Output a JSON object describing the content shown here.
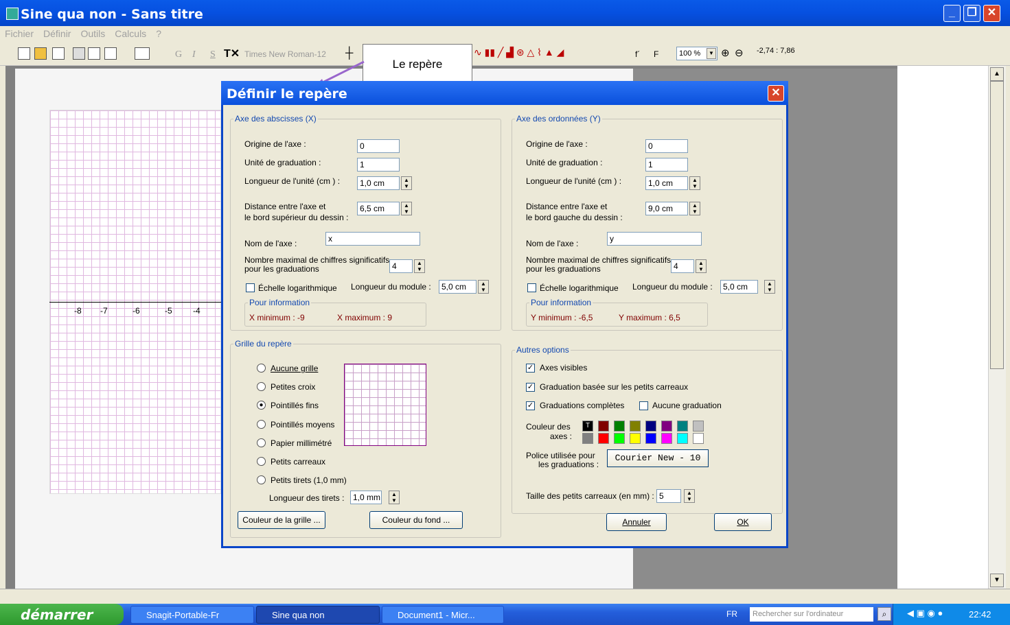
{
  "window": {
    "title": "Sine qua non - Sans titre"
  },
  "menu": [
    "Fichier",
    "Définir",
    "Outils",
    "Calculs",
    "?"
  ],
  "toolbar": {
    "font": "Times New Roman-12",
    "zoom": "100 %",
    "coord": "-2,74 : 7,86",
    "tooltip": "Le repère",
    "bold": "G",
    "italic": "I",
    "strike": "S",
    "f_prime": "f´",
    "f": "F"
  },
  "graph": {
    "ticks": [
      "-8",
      "-7",
      "-6",
      "-5",
      "-4"
    ]
  },
  "dialog": {
    "title": "Définir le repère",
    "x_axis": {
      "legend": "Axe des abscisses (X)",
      "origin_label": "Origine de l'axe :",
      "origin": "0",
      "unit_label": "Unité de graduation :",
      "unit": "1",
      "length_label": "Longueur de l'unité (cm ) :",
      "length": "1,0 cm",
      "dist_label1": "Distance entre l'axe et",
      "dist_label2": "le bord supérieur du dessin :",
      "dist": "6,5 cm",
      "name_label": "Nom de l'axe :",
      "name": "x",
      "sig_label1": "Nombre maximal de chiffres significatifs",
      "sig_label2": "pour les graduations",
      "sig": "4",
      "log_label": "Échelle logarithmique",
      "module_label": "Longueur du module :",
      "module": "5,0 cm",
      "info_legend": "Pour information",
      "min": "X minimum : -9",
      "max": "X maximum : 9"
    },
    "y_axis": {
      "legend": "Axe des ordonnées (Y)",
      "origin_label": "Origine de l'axe :",
      "origin": "0",
      "unit_label": "Unité de graduation :",
      "unit": "1",
      "length_label": "Longueur de l'unité (cm ) :",
      "length": "1,0 cm",
      "dist_label1": "Distance entre l'axe et",
      "dist_label2": "le bord gauche du dessin :",
      "dist": "9,0 cm",
      "name_label": "Nom de l'axe :",
      "name": "y",
      "sig_label1": "Nombre maximal de chiffres significatifs",
      "sig_label2": "pour les graduations",
      "sig": "4",
      "log_label": "Échelle logarithmique",
      "module_label": "Longueur du module :",
      "module": "5,0 cm",
      "info_legend": "Pour information",
      "min": "Y minimum : -6,5",
      "max": "Y maximum : 6,5"
    },
    "grid": {
      "legend": "Grille du repère",
      "options": [
        "Aucune grille",
        "Petites croix",
        "Pointillés fins",
        "Pointillés moyens",
        "Papier millimétré",
        "Petits carreaux",
        "Petits tirets (1,0 mm)"
      ],
      "selected_index": 2,
      "dash_label": "Longueur des tirets :",
      "dash": "1,0 mm",
      "grid_color_btn": "Couleur de la grille ...",
      "bg_color_btn": "Couleur du fond ..."
    },
    "other": {
      "legend": "Autres options",
      "axes_visible": "Axes visibles",
      "grad_small": "Graduation basée sur les petits carreaux",
      "grad_full": "Graduations complètes",
      "no_grad": "Aucune graduation",
      "color_label1": "Couleur des",
      "color_label2": "axes :",
      "font_label1": "Police utilisée pour",
      "font_label2": "les graduations :",
      "font_value": "Courier New - 10",
      "size_label": "Taille des petits carreaux (en mm) :",
      "size": "5",
      "colors_row1": [
        "#000000",
        "#800000",
        "#008000",
        "#808000",
        "#000080",
        "#800080",
        "#008080",
        "#c0c0c0"
      ],
      "colors_row2": [
        "#808080",
        "#ff0000",
        "#00ff00",
        "#ffff00",
        "#0000ff",
        "#ff00ff",
        "#00ffff",
        "#ffffff"
      ],
      "selected_swatch_mark": "T"
    },
    "cancel": "Annuler",
    "ok": "OK"
  },
  "taskbar": {
    "start": "démarrer",
    "tasks": [
      "Snagit-Portable-Fr",
      "Sine qua non",
      "Document1 - Micr..."
    ],
    "lang": "FR",
    "search": "Rechercher sur l'ordinateur",
    "time": "22:42"
  }
}
